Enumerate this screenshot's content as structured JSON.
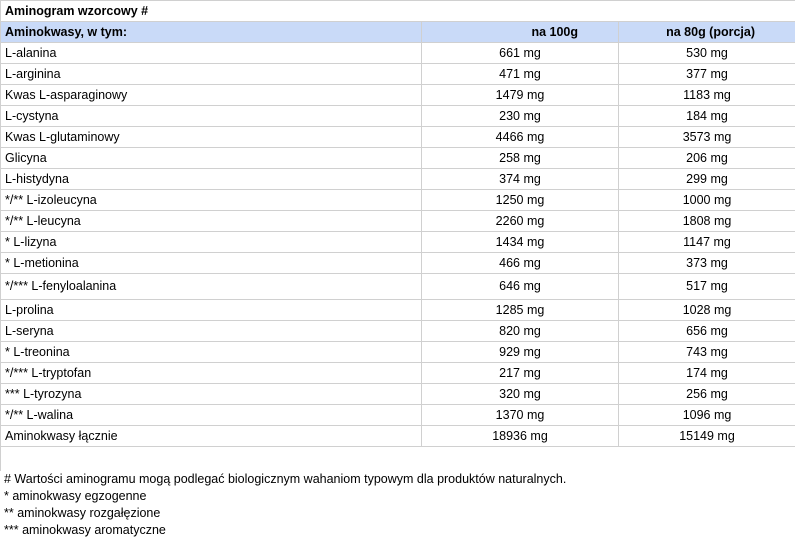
{
  "title": "Aminogram wzorcowy #",
  "header": {
    "col1": "Aminokwasy, w tym:",
    "col2": "na 100g",
    "col3": "na 80g (porcja)"
  },
  "rows": [
    {
      "name": "L-alanina",
      "v100": "661 mg",
      "v80": "530 mg"
    },
    {
      "name": "L-arginina",
      "v100": "471 mg",
      "v80": "377 mg"
    },
    {
      "name": "Kwas L-asparaginowy",
      "v100": "1479 mg",
      "v80": "1183 mg"
    },
    {
      "name": "L-cystyna",
      "v100": "230 mg",
      "v80": "184 mg"
    },
    {
      "name": "Kwas L-glutaminowy",
      "v100": "4466 mg",
      "v80": "3573 mg"
    },
    {
      "name": "Glicyna",
      "v100": "258 mg",
      "v80": "206 mg"
    },
    {
      "name": "L-histydyna",
      "v100": "374 mg",
      "v80": "299 mg"
    },
    {
      "name": "*/** L-izoleucyna",
      "v100": "1250 mg",
      "v80": "1000 mg"
    },
    {
      "name": "*/** L-leucyna",
      "v100": "2260 mg",
      "v80": "1808 mg"
    },
    {
      "name": "* L-lizyna",
      "v100": "1434 mg",
      "v80": "1147 mg"
    },
    {
      "name": "* L-metionina",
      "v100": "466 mg",
      "v80": "373 mg"
    },
    {
      "name": "*/*** L-fenyloalanina",
      "v100": "646 mg",
      "v80": "517 mg"
    },
    {
      "name": "L-prolina",
      "v100": "1285 mg",
      "v80": "1028 mg"
    },
    {
      "name": "L-seryna",
      "v100": "820 mg",
      "v80": "656 mg"
    },
    {
      "name": "* L-treonina",
      "v100": "929 mg",
      "v80": "743 mg"
    },
    {
      "name": "*/*** L-tryptofan",
      "v100": "217 mg",
      "v80": "174 mg"
    },
    {
      "name": "*** L-tyrozyna",
      "v100": "320 mg",
      "v80": "256 mg"
    },
    {
      "name": "*/** L-walina",
      "v100": "1370 mg",
      "v80": "1096 mg"
    },
    {
      "name": "Aminokwasy łącznie",
      "v100": "18936 mg",
      "v80": "15149 mg"
    }
  ],
  "notes": [
    "# Wartości aminogramu mogą podlegać biologicznym wahaniom typowym dla produktów naturalnych.",
    "* aminokwasy egzogenne",
    "** aminokwasy rozgałęzione",
    "*** aminokwasy aromatyczne"
  ]
}
